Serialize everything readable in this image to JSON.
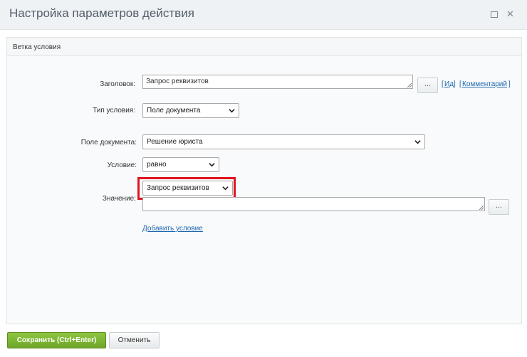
{
  "window": {
    "title": "Настройка параметров действия"
  },
  "section": {
    "title": "Ветка условия"
  },
  "form": {
    "heading_label": "Заголовок:",
    "heading_value": "Запрос реквизитов",
    "heading_dots": "...",
    "id_link": "Ид",
    "comment_link": "Комментарий",
    "open_bracket": "[",
    "close_bracket": "]",
    "condition_type_label": "Тип условия:",
    "condition_type_value": "Поле документа",
    "doc_field_label": "Поле документа:",
    "doc_field_value": "Решение юриста",
    "condition_label": "Условие:",
    "condition_value": "равно",
    "value_label": "Значение:",
    "value_select": "Запрос реквизитов",
    "value_text": "",
    "value_dots": "...",
    "add_condition": "Добавить условие"
  },
  "footer": {
    "save_label": "Сохранить (Ctrl+Enter)",
    "cancel_label": "Отменить"
  },
  "colors": {
    "save": "#7cb533",
    "link": "#2067b0",
    "highlight": "#e0141e"
  }
}
